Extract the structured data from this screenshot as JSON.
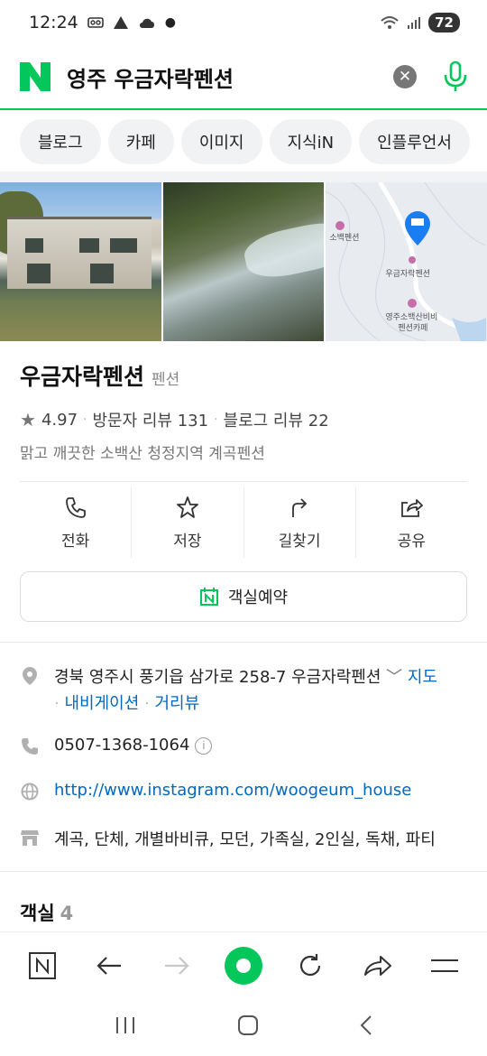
{
  "status_bar": {
    "time": "12:24",
    "battery": "72"
  },
  "search": {
    "query": "영주 우금자락펜션"
  },
  "chips": [
    "블로그",
    "카페",
    "이미지",
    "지식iN",
    "인플루언서"
  ],
  "map": {
    "labels": [
      "소백펜션",
      "우금자락펜션",
      "영주소백산비비",
      "펜션카페"
    ]
  },
  "place": {
    "name": "우금자락펜션",
    "category": "펜션",
    "rating": "4.97",
    "visitor_reviews": "방문자 리뷰 131",
    "blog_reviews": "블로그 리뷰 22",
    "description": "맑고 깨끗한 소백산 청정지역 계곡펜션"
  },
  "actions": [
    {
      "label": "전화",
      "icon": "phone-icon"
    },
    {
      "label": "저장",
      "icon": "star-icon"
    },
    {
      "label": "길찾기",
      "icon": "directions-icon"
    },
    {
      "label": "공유",
      "icon": "share-icon"
    }
  ],
  "reserve": {
    "label": "객실예약"
  },
  "details": {
    "address": "경북 영주시 풍기읍 삼가로 258-7 우금자락펜션",
    "map_link": "지도",
    "navigation_link": "내비게이션",
    "streetview_link": "거리뷰",
    "phone": "0507-1368-1064",
    "website": "http://www.instagram.com/woogeum_house",
    "amenities": "계곡, 단체, 개별바비큐, 모던, 가족실, 2인실, 독채, 파티"
  },
  "rooms": {
    "title": "객실",
    "count": "4"
  },
  "colors": {
    "brand": "#03c75a",
    "link": "#0068c3"
  }
}
